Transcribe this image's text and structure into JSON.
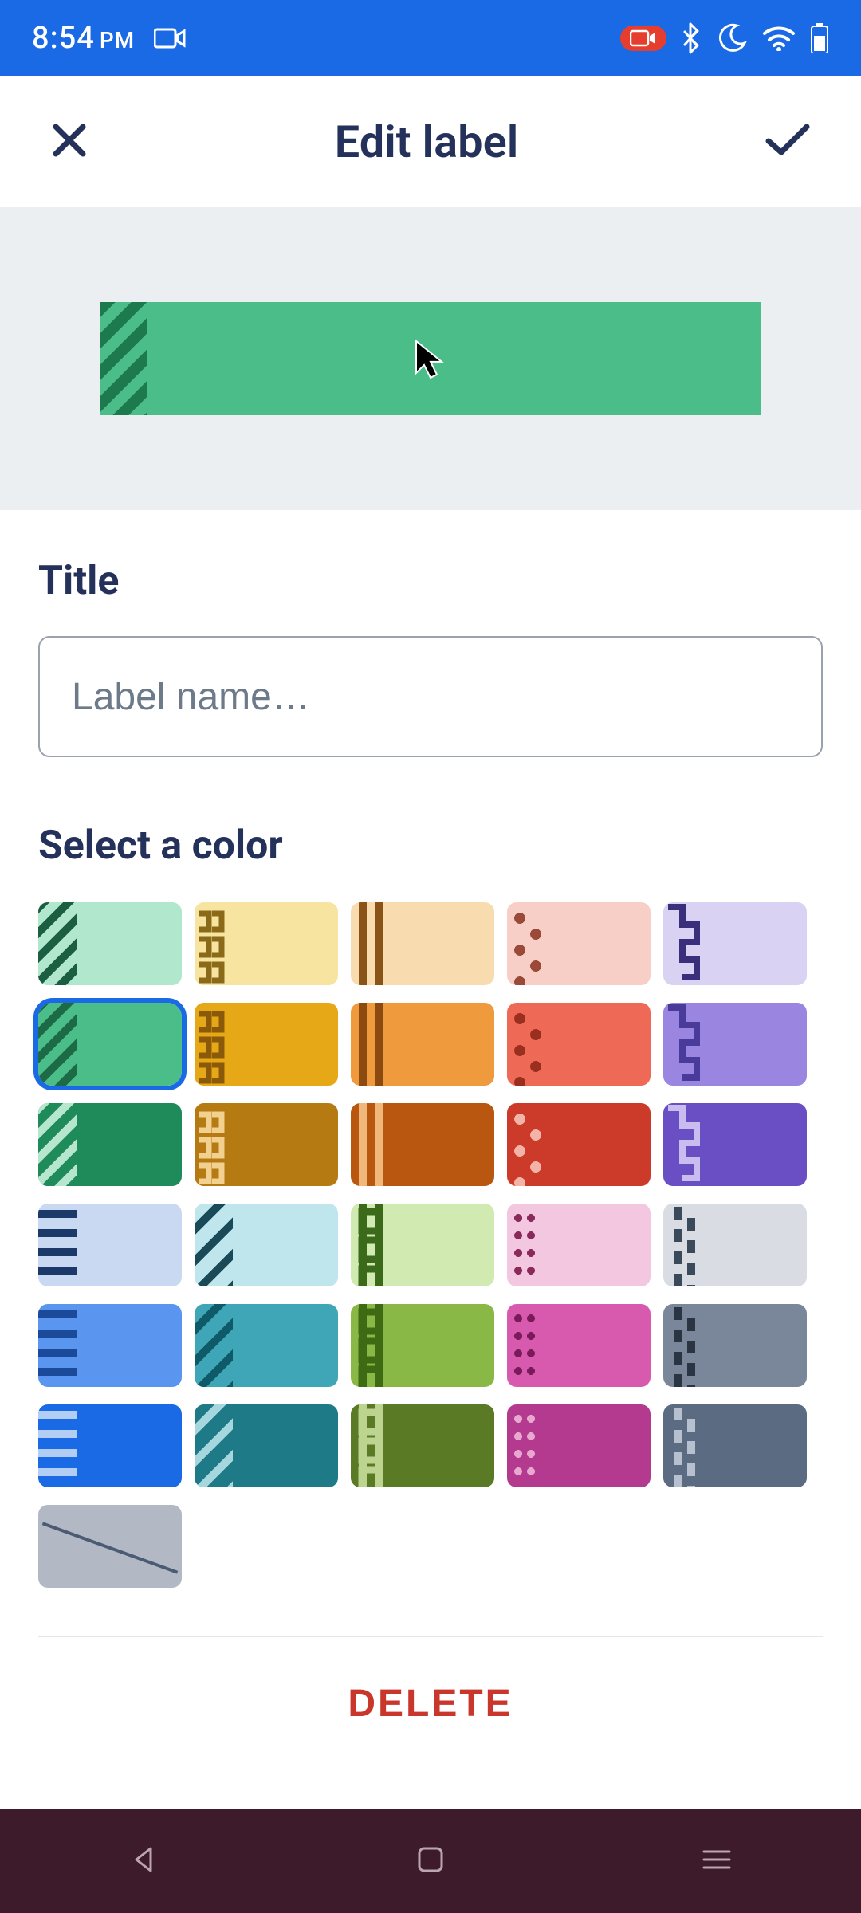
{
  "status": {
    "time": "8:54",
    "ampm": "PM",
    "icons_left": [
      "camera-icon"
    ],
    "icons_right": [
      "screen-record-icon",
      "bluetooth-icon",
      "dnd-moon-icon",
      "wifi-icon",
      "battery-icon"
    ]
  },
  "header": {
    "title": "Edit label",
    "close_label": "Close",
    "confirm_label": "Confirm"
  },
  "preview": {
    "color": "#4bbd88",
    "accent": "#1c7a4e"
  },
  "title_section": {
    "label": "Title",
    "placeholder": "Label name…",
    "value": ""
  },
  "color_section": {
    "label": "Select a color",
    "selected_index": 5,
    "swatches": [
      {
        "bg": "#b0e7cd",
        "ac": "#1b5e42",
        "col": 0,
        "row": 0
      },
      {
        "bg": "#f6e4a0",
        "ac": "#8a6a18",
        "col": 1,
        "row": 0
      },
      {
        "bg": "#f8dcb0",
        "ac": "#8a5418",
        "col": 2,
        "row": 0
      },
      {
        "bg": "#f8cfc7",
        "ac": "#9b4a3a",
        "col": 3,
        "row": 0
      },
      {
        "bg": "#d9d2f3",
        "ac": "#3a2f7a",
        "col": 4,
        "row": 0
      },
      {
        "bg": "#4bbd88",
        "ac": "#1c6a46",
        "col": 0,
        "row": 1
      },
      {
        "bg": "#e6a817",
        "ac": "#8a5a0a",
        "col": 1,
        "row": 1
      },
      {
        "bg": "#f09a3e",
        "ac": "#8a4a10",
        "col": 2,
        "row": 1
      },
      {
        "bg": "#ee6a56",
        "ac": "#9a2f20",
        "col": 3,
        "row": 1
      },
      {
        "bg": "#9a85e0",
        "ac": "#4a3a9a",
        "col": 4,
        "row": 1
      },
      {
        "bg": "#1f8a5a",
        "ac": "#b7e6cf",
        "col": 0,
        "row": 2
      },
      {
        "bg": "#b57a12",
        "ac": "#f1d090",
        "col": 1,
        "row": 2
      },
      {
        "bg": "#b9560f",
        "ac": "#f1b87c",
        "col": 2,
        "row": 2
      },
      {
        "bg": "#cc3a2a",
        "ac": "#f3b3a8",
        "col": 3,
        "row": 2
      },
      {
        "bg": "#6a4fc4",
        "ac": "#c9bdf0",
        "col": 4,
        "row": 2
      },
      {
        "bg": "#c9d9f2",
        "ac": "#1b3a6a",
        "col": 0,
        "row": 3
      },
      {
        "bg": "#bfe6ec",
        "ac": "#1a4a57",
        "col": 1,
        "row": 3
      },
      {
        "bg": "#d0eab2",
        "ac": "#3a6a1a",
        "col": 2,
        "row": 3
      },
      {
        "bg": "#f3c7e0",
        "ac": "#8a2a5a",
        "col": 3,
        "row": 3
      },
      {
        "bg": "#d9dde3",
        "ac": "#3a4a5a",
        "col": 4,
        "row": 3
      },
      {
        "bg": "#5a96f0",
        "ac": "#1b4a9a",
        "col": 0,
        "row": 4
      },
      {
        "bg": "#3fa6b7",
        "ac": "#0f5a68",
        "col": 1,
        "row": 4
      },
      {
        "bg": "#8ab847",
        "ac": "#3f6a14",
        "col": 2,
        "row": 4
      },
      {
        "bg": "#d85aae",
        "ac": "#7a1a5a",
        "col": 3,
        "row": 4
      },
      {
        "bg": "#7a8699",
        "ac": "#2a3443",
        "col": 4,
        "row": 4
      },
      {
        "bg": "#1b6ae5",
        "ac": "#b3cef5",
        "col": 0,
        "row": 5
      },
      {
        "bg": "#1f7a88",
        "ac": "#a6d6de",
        "col": 1,
        "row": 5
      },
      {
        "bg": "#5a7a26",
        "ac": "#bcd490",
        "col": 2,
        "row": 5
      },
      {
        "bg": "#b33a8f",
        "ac": "#e8a8d0",
        "col": 3,
        "row": 5
      },
      {
        "bg": "#5a6b82",
        "ac": "#b6c0cf",
        "col": 4,
        "row": 5
      },
      {
        "bg": "#b3b9c4",
        "ac": "#4b5b73",
        "col": -1,
        "row": 6,
        "none": true
      }
    ]
  },
  "delete": {
    "label": "DELETE"
  },
  "nav": {
    "items": [
      "back",
      "home",
      "recents"
    ]
  }
}
